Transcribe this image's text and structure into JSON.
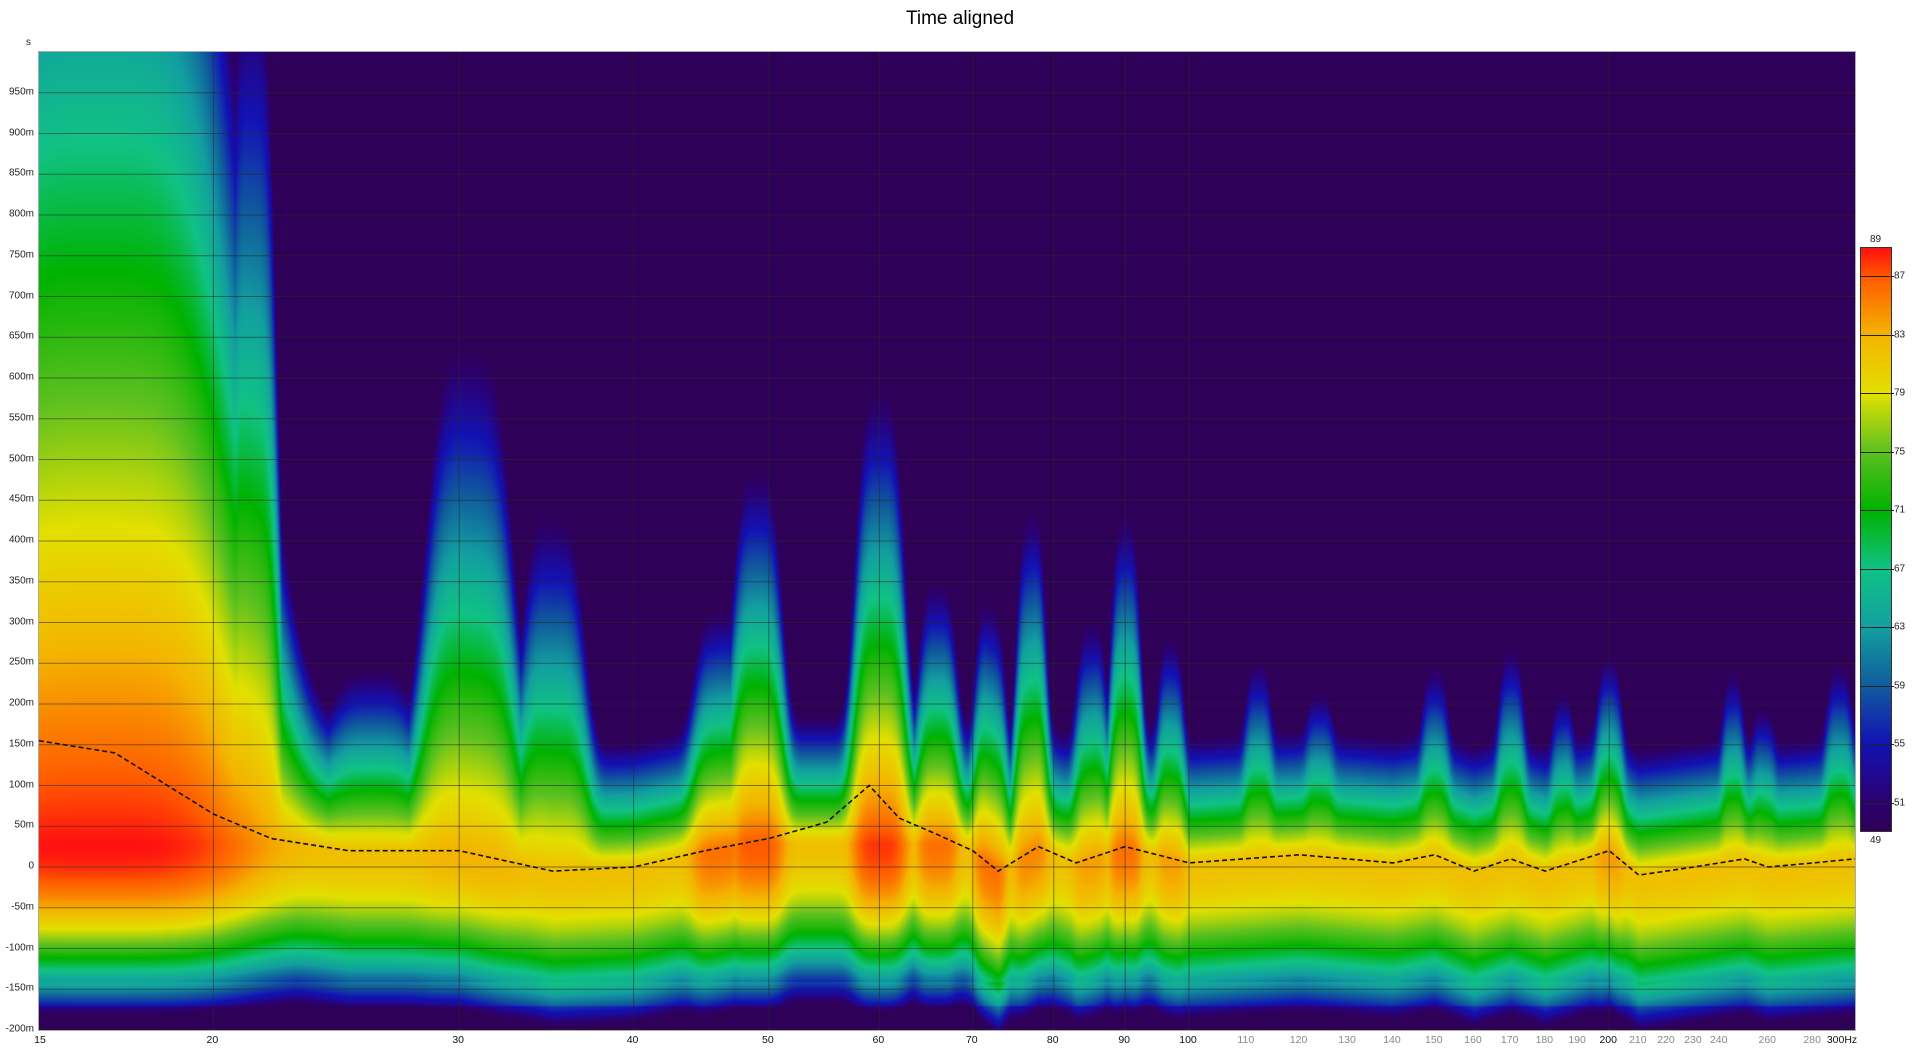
{
  "chart_data": {
    "type": "heatmap",
    "title": "Time aligned",
    "xlabel": "Hz",
    "ylabel": "s",
    "x_scale": "log",
    "xlim": [
      15,
      300
    ],
    "ylim": [
      -0.2,
      1.0
    ],
    "x_ticks_major": [
      "15",
      "20",
      "30",
      "40",
      "50",
      "60",
      "70",
      "80",
      "90",
      "100",
      "200",
      "300Hz"
    ],
    "x_ticks_major_values": [
      15,
      20,
      30,
      40,
      50,
      60,
      70,
      80,
      90,
      100,
      200,
      300
    ],
    "x_ticks_minor": [
      "110",
      "120",
      "130",
      "140",
      "150",
      "160",
      "170",
      "180",
      "190",
      "210",
      "220",
      "230",
      "240",
      "260",
      "280"
    ],
    "x_ticks_minor_values": [
      110,
      120,
      130,
      140,
      150,
      160,
      170,
      180,
      190,
      210,
      220,
      230,
      240,
      260,
      280
    ],
    "y_ticks": [
      "950m",
      "900m",
      "850m",
      "800m",
      "750m",
      "700m",
      "650m",
      "600m",
      "550m",
      "500m",
      "450m",
      "400m",
      "350m",
      "300m",
      "250m",
      "200m",
      "150m",
      "100m",
      "50m",
      "0",
      "-50m",
      "-100m",
      "-150m",
      "-200m"
    ],
    "y_tick_values": [
      0.95,
      0.9,
      0.85,
      0.8,
      0.75,
      0.7,
      0.65,
      0.6,
      0.55,
      0.5,
      0.45,
      0.4,
      0.35,
      0.3,
      0.25,
      0.2,
      0.15,
      0.1,
      0.05,
      0,
      -0.05,
      -0.1,
      -0.15,
      -0.2
    ],
    "colorbar": {
      "min_label": "49",
      "max_label": "89",
      "min": 49,
      "max": 89,
      "tick_labels": [
        "87",
        "83",
        "79",
        "75",
        "71",
        "67",
        "63",
        "59",
        "55",
        "51"
      ],
      "tick_values": [
        87,
        83,
        79,
        75,
        71,
        67,
        63,
        59,
        55,
        51
      ],
      "stops": [
        [
          49,
          "#2e0057"
        ],
        [
          51,
          "#2c0070"
        ],
        [
          55,
          "#1212b4"
        ],
        [
          59,
          "#105c9c"
        ],
        [
          63,
          "#12a0a0"
        ],
        [
          67,
          "#10c284"
        ],
        [
          71,
          "#00b200"
        ],
        [
          75,
          "#5cc020"
        ],
        [
          79,
          "#e2e000"
        ],
        [
          83,
          "#f4b400"
        ],
        [
          87,
          "#ff5a00"
        ],
        [
          89,
          "#ff1010"
        ]
      ]
    },
    "decay_modes": [
      {
        "freq": 16.5,
        "width": 0.115,
        "decay_end_s": 1.6,
        "peak_db": 89
      },
      {
        "freq": 21.3,
        "width": 0.02,
        "decay_end_s": 1.1,
        "peak_db": 84
      },
      {
        "freq": 26,
        "width": 0.03,
        "decay_end_s": 0.23,
        "peak_db": 82
      },
      {
        "freq": 30.5,
        "width": 0.035,
        "decay_end_s": 0.64,
        "peak_db": 83
      },
      {
        "freq": 35,
        "width": 0.025,
        "decay_end_s": 0.45,
        "peak_db": 82
      },
      {
        "freq": 46,
        "width": 0.02,
        "decay_end_s": 0.3,
        "peak_db": 86
      },
      {
        "freq": 49,
        "width": 0.02,
        "decay_end_s": 0.47,
        "peak_db": 87
      },
      {
        "freq": 60,
        "width": 0.02,
        "decay_end_s": 0.57,
        "peak_db": 88
      },
      {
        "freq": 66,
        "width": 0.015,
        "decay_end_s": 0.33,
        "peak_db": 86
      },
      {
        "freq": 72,
        "width": 0.012,
        "decay_end_s": 0.33,
        "peak_db": 86
      },
      {
        "freq": 77,
        "width": 0.012,
        "decay_end_s": 0.43,
        "peak_db": 85
      },
      {
        "freq": 85,
        "width": 0.012,
        "decay_end_s": 0.3,
        "peak_db": 84
      },
      {
        "freq": 90,
        "width": 0.012,
        "decay_end_s": 0.42,
        "peak_db": 86
      },
      {
        "freq": 97,
        "width": 0.01,
        "decay_end_s": 0.28,
        "peak_db": 84
      },
      {
        "freq": 112,
        "width": 0.01,
        "decay_end_s": 0.25,
        "peak_db": 82
      },
      {
        "freq": 124,
        "width": 0.01,
        "decay_end_s": 0.21,
        "peak_db": 82
      },
      {
        "freq": 150,
        "width": 0.01,
        "decay_end_s": 0.24,
        "peak_db": 82
      },
      {
        "freq": 170,
        "width": 0.01,
        "decay_end_s": 0.27,
        "peak_db": 82
      },
      {
        "freq": 185,
        "width": 0.008,
        "decay_end_s": 0.22,
        "peak_db": 82
      },
      {
        "freq": 200,
        "width": 0.01,
        "decay_end_s": 0.25,
        "peak_db": 84
      },
      {
        "freq": 245,
        "width": 0.008,
        "decay_end_s": 0.24,
        "peak_db": 82
      },
      {
        "freq": 258,
        "width": 0.008,
        "decay_end_s": 0.2,
        "peak_db": 81
      },
      {
        "freq": 292,
        "width": 0.01,
        "decay_end_s": 0.25,
        "peak_db": 82
      }
    ],
    "base_decay_end_s": 0.16,
    "base_peak_db": 82,
    "peak_time_curve": {
      "x": [
        15,
        17,
        20,
        22,
        25,
        30,
        35,
        40,
        45,
        50,
        55,
        59,
        62,
        66,
        70,
        73,
        78,
        83,
        90,
        100,
        120,
        140,
        150,
        160,
        170,
        180,
        200,
        210,
        230,
        250,
        260,
        280,
        300
      ],
      "y": [
        0.155,
        0.14,
        0.065,
        0.035,
        0.02,
        0.02,
        -0.005,
        0,
        0.02,
        0.035,
        0.055,
        0.1,
        0.06,
        0.04,
        0.02,
        -0.005,
        0.025,
        0.005,
        0.025,
        0.005,
        0.015,
        0.005,
        0.015,
        -0.005,
        0.01,
        -0.005,
        0.02,
        -0.01,
        0,
        0.01,
        0,
        0.005,
        0.01
      ]
    }
  }
}
